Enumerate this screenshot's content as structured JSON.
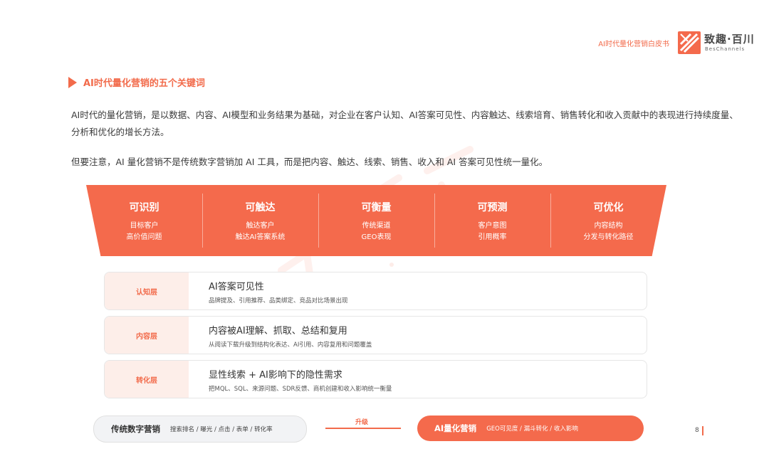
{
  "header": {
    "doc_title": "AI时代量化营销白皮书",
    "logo_cn": "致趣·百川",
    "logo_en": "BesChannels"
  },
  "section": {
    "title": "AI时代量化营销的五个关键词"
  },
  "paragraphs": [
    "AI时代的量化营销，是以数据、内容、AI模型和业务结果为基础，对企业在客户认知、AI答案可见性、内容触达、线索培育、销售转化和收入贡献中的表现进行持续度量、分析和优化的增长方法。",
    "但要注意，AI 量化营销不是传统数字营销加 AI 工具，而是把内容、触达、线索、销售、收入和 AI 答案可见性统一量化。"
  ],
  "pillars": [
    {
      "title": "可识别",
      "line1": "目标客户",
      "line2": "高价值问题"
    },
    {
      "title": "可触达",
      "line1": "触达客户",
      "line2": "触达AI答案系统"
    },
    {
      "title": "可衡量",
      "line1": "传统渠道",
      "line2": "GEO表现"
    },
    {
      "title": "可预测",
      "line1": "客户意图",
      "line2": "引用概率"
    },
    {
      "title": "可优化",
      "line1": "内容结构",
      "line2": "分发与转化路径"
    }
  ],
  "layers": [
    {
      "tag": "认知层",
      "title": "AI答案可见性",
      "desc": "品牌提及、引用推荐、品类绑定、竞品对比场景出现"
    },
    {
      "tag": "内容层",
      "title": "内容被AI理解、抓取、总结和复用",
      "desc": "从阅读下载升级到结构化表达、AI引用、内容复用和问题覆盖"
    },
    {
      "tag": "转化层",
      "title": "显性线索 + AI影响下的隐性需求",
      "desc": "把MQL、SQL、来源问题、SDR反馈、商机创建和收入影响统一衡量"
    }
  ],
  "comparison": {
    "traditional": {
      "name": "传统数字营销",
      "metrics": "搜索排名 / 曝光 / 点击 / 表单 / 转化率"
    },
    "upgrade_label": "升级",
    "ai": {
      "name": "AI量化营销",
      "metrics": "GEO可见度 / 漏斗转化 / 收入影响"
    }
  },
  "footer": {
    "page_number": "8"
  },
  "colors": {
    "accent": "#f46a4c",
    "accent_light": "#fdeee9",
    "text": "#333333"
  }
}
